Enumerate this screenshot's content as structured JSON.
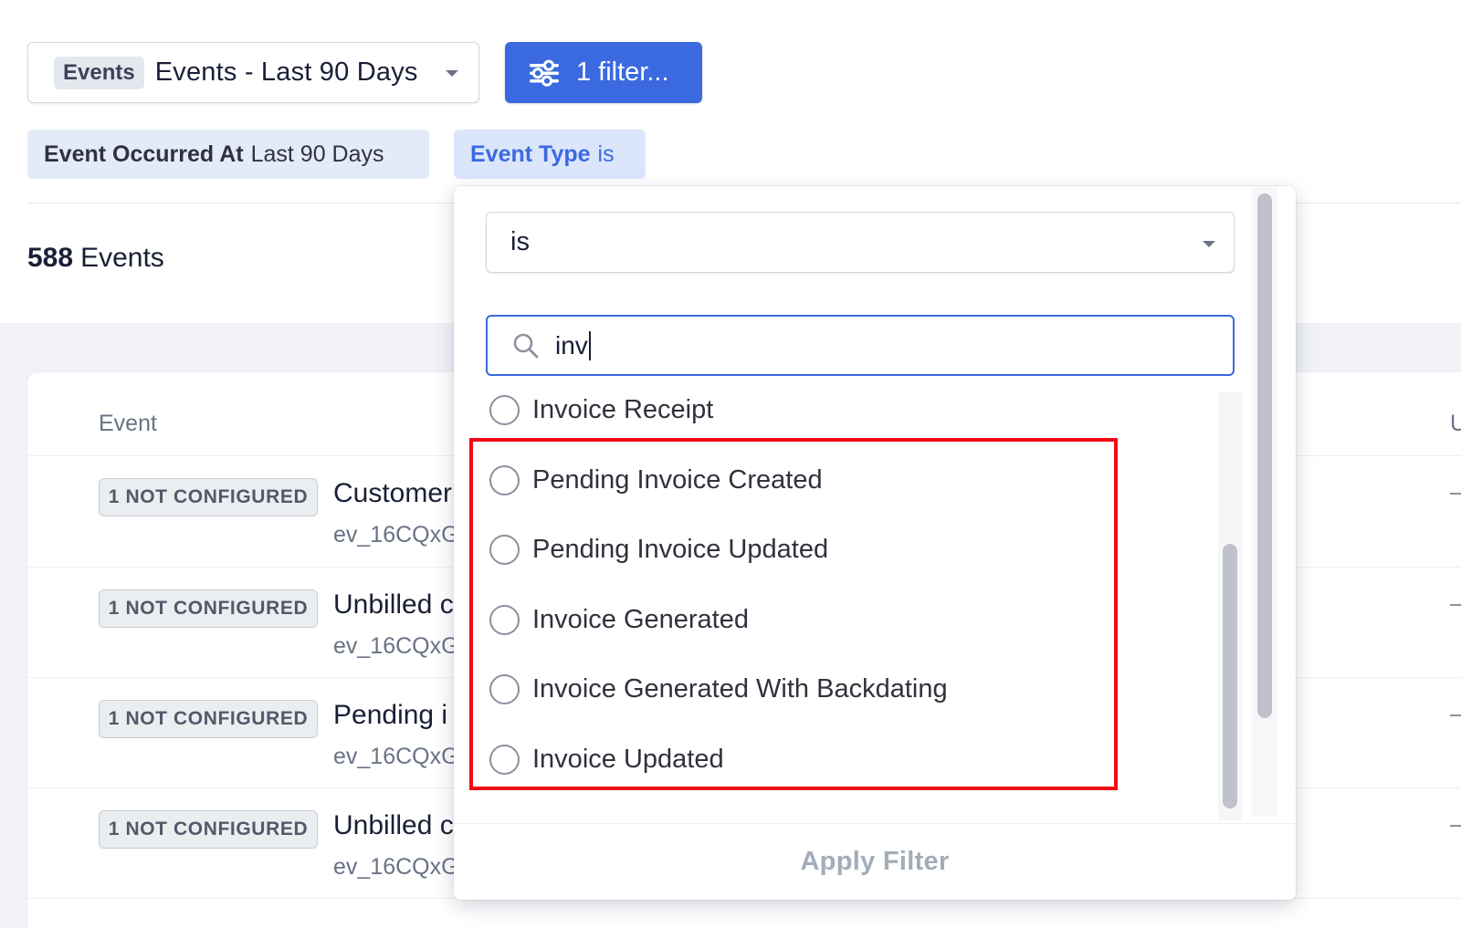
{
  "toolbar": {
    "view_tag": "Events",
    "view_title": "Events - Last 90 Days",
    "filter_button_label": "1 filter..."
  },
  "filters": {
    "date_pill": {
      "field": "Event Occurred At",
      "value": "Last 90 Days"
    },
    "type_pill": {
      "field": "Event Type",
      "operator": "is"
    }
  },
  "summary": {
    "count": "588",
    "count_label": "Events"
  },
  "table": {
    "columns": [
      "Event",
      "U"
    ],
    "rows": [
      {
        "badge": "1 NOT CONFIGURED",
        "title": "Customer",
        "id": "ev_16CQxG",
        "trailing": "—"
      },
      {
        "badge": "1 NOT CONFIGURED",
        "title": "Unbilled c",
        "id": "ev_16CQxG",
        "trailing": "—"
      },
      {
        "badge": "1 NOT CONFIGURED",
        "title": "Pending i",
        "id": "ev_16CQxG",
        "trailing": "—"
      },
      {
        "badge": "1 NOT CONFIGURED",
        "title": "Unbilled c",
        "id": "ev_16CQxG",
        "trailing": "—"
      }
    ]
  },
  "popover": {
    "operator_value": "is",
    "search_value": "inv",
    "options": [
      "Invoice Receipt",
      "Pending Invoice Created",
      "Pending Invoice Updated",
      "Invoice Generated",
      "Invoice Generated With Backdating",
      "Invoice Updated"
    ],
    "apply_label": "Apply Filter"
  },
  "colors": {
    "accent": "#3b6ae0",
    "highlight": "#f20c14",
    "pill_bg": "#dbe6fb"
  }
}
